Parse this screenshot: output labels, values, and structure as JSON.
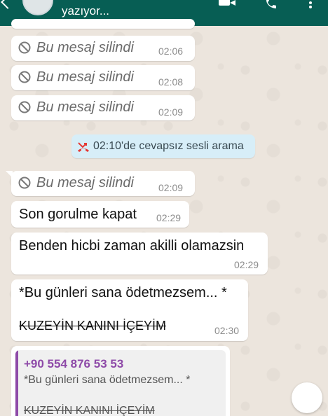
{
  "header": {
    "status": "yazıyor..."
  },
  "messages": [
    {
      "text": "Bu mesaj silindi",
      "time": "02:06"
    },
    {
      "text": "Bu mesaj silindi",
      "time": "02:08"
    },
    {
      "text": "Bu mesaj silindi",
      "time": "02:09"
    },
    {
      "system": "02:10'de cevapsız sesli arama"
    },
    {
      "text": "Bu mesaj silindi",
      "time": "02:09"
    },
    {
      "text": "Son gorulme kapat",
      "time": "02:29"
    },
    {
      "text": "Benden hicbi zaman akilli olamazsin",
      "time": "02:29"
    },
    {
      "line1": "*Bu günleri sana ödetmezsem... *",
      "line2": "KUZEYİN KANINI İÇEYİM",
      "time": "02:30"
    }
  ],
  "reply": {
    "author": "+90 554 876 53 53",
    "line1": "*Bu günleri sana ödetmezsem... *",
    "line2": "KUZEYİN KANINI İÇEYİM"
  },
  "colors": {
    "header": "#075e54",
    "quote_accent": "#8e4aa8",
    "missed_call": "#e53935"
  }
}
